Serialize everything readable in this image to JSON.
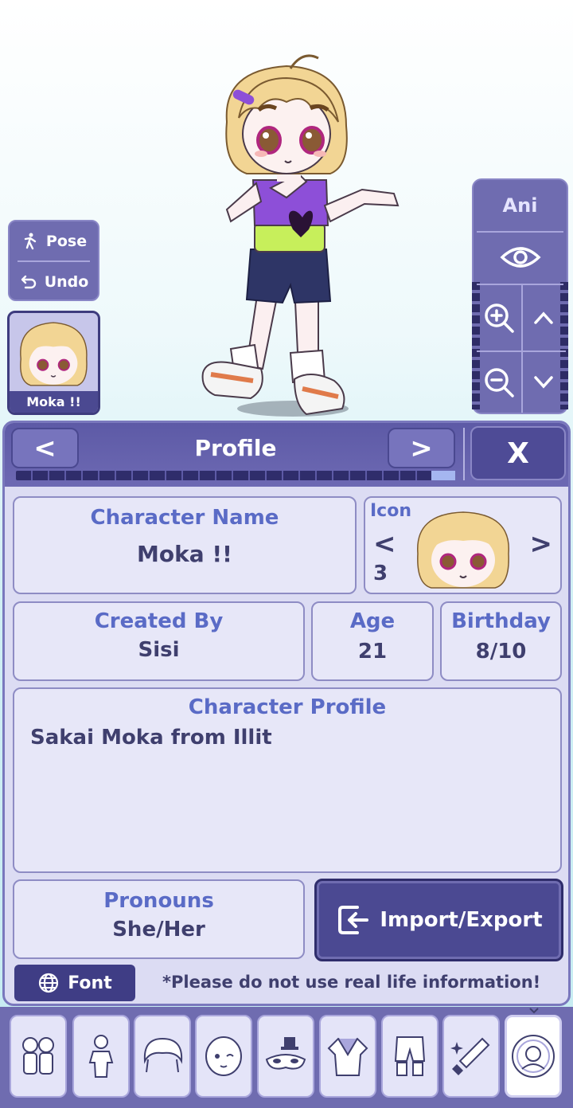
{
  "stage": {
    "pose_label": "Pose",
    "undo_label": "Undo",
    "character_thumb_name": "Moka !!",
    "ani_label": "Ani",
    "icons": [
      "pose-icon",
      "undo-icon",
      "eye-icon",
      "zoom-in-icon",
      "zoom-out-icon",
      "chevron-up-icon",
      "chevron-down-icon"
    ]
  },
  "profile": {
    "title": "Profile",
    "prev_label": "<",
    "next_label": ">",
    "close_label": "X",
    "character_name_label": "Character Name",
    "character_name": "Moka !!",
    "icon_label": "Icon",
    "icon_prev": "<",
    "icon_next": ">",
    "icon_number": "3",
    "created_by_label": "Created By",
    "created_by": "Sisi",
    "age_label": "Age",
    "age": "21",
    "birthday_label": "Birthday",
    "birthday": "8/10",
    "character_profile_label": "Character Profile",
    "character_profile_text": "Sakai Moka from Illit",
    "pronouns_label": "Pronouns",
    "pronouns": "She/Her",
    "import_export_label": "Import/Export",
    "font_label": "Font",
    "notice": "*Please do not use real life information!"
  },
  "toolbar": {
    "items": [
      {
        "icon": "characters-icon"
      },
      {
        "icon": "body-icon"
      },
      {
        "icon": "hair-icon"
      },
      {
        "icon": "face-icon"
      },
      {
        "icon": "accessories-icon"
      },
      {
        "icon": "top-icon"
      },
      {
        "icon": "bottom-icon"
      },
      {
        "icon": "props-icon"
      },
      {
        "icon": "profile-icon",
        "active": true
      }
    ]
  },
  "colors": {
    "panel_bg": "#dcdcf3",
    "header_bg": "#5d5aa6",
    "label_blue": "#5a6bc6",
    "text_dark": "#3f3f6e",
    "button_dark": "#4b4992"
  }
}
